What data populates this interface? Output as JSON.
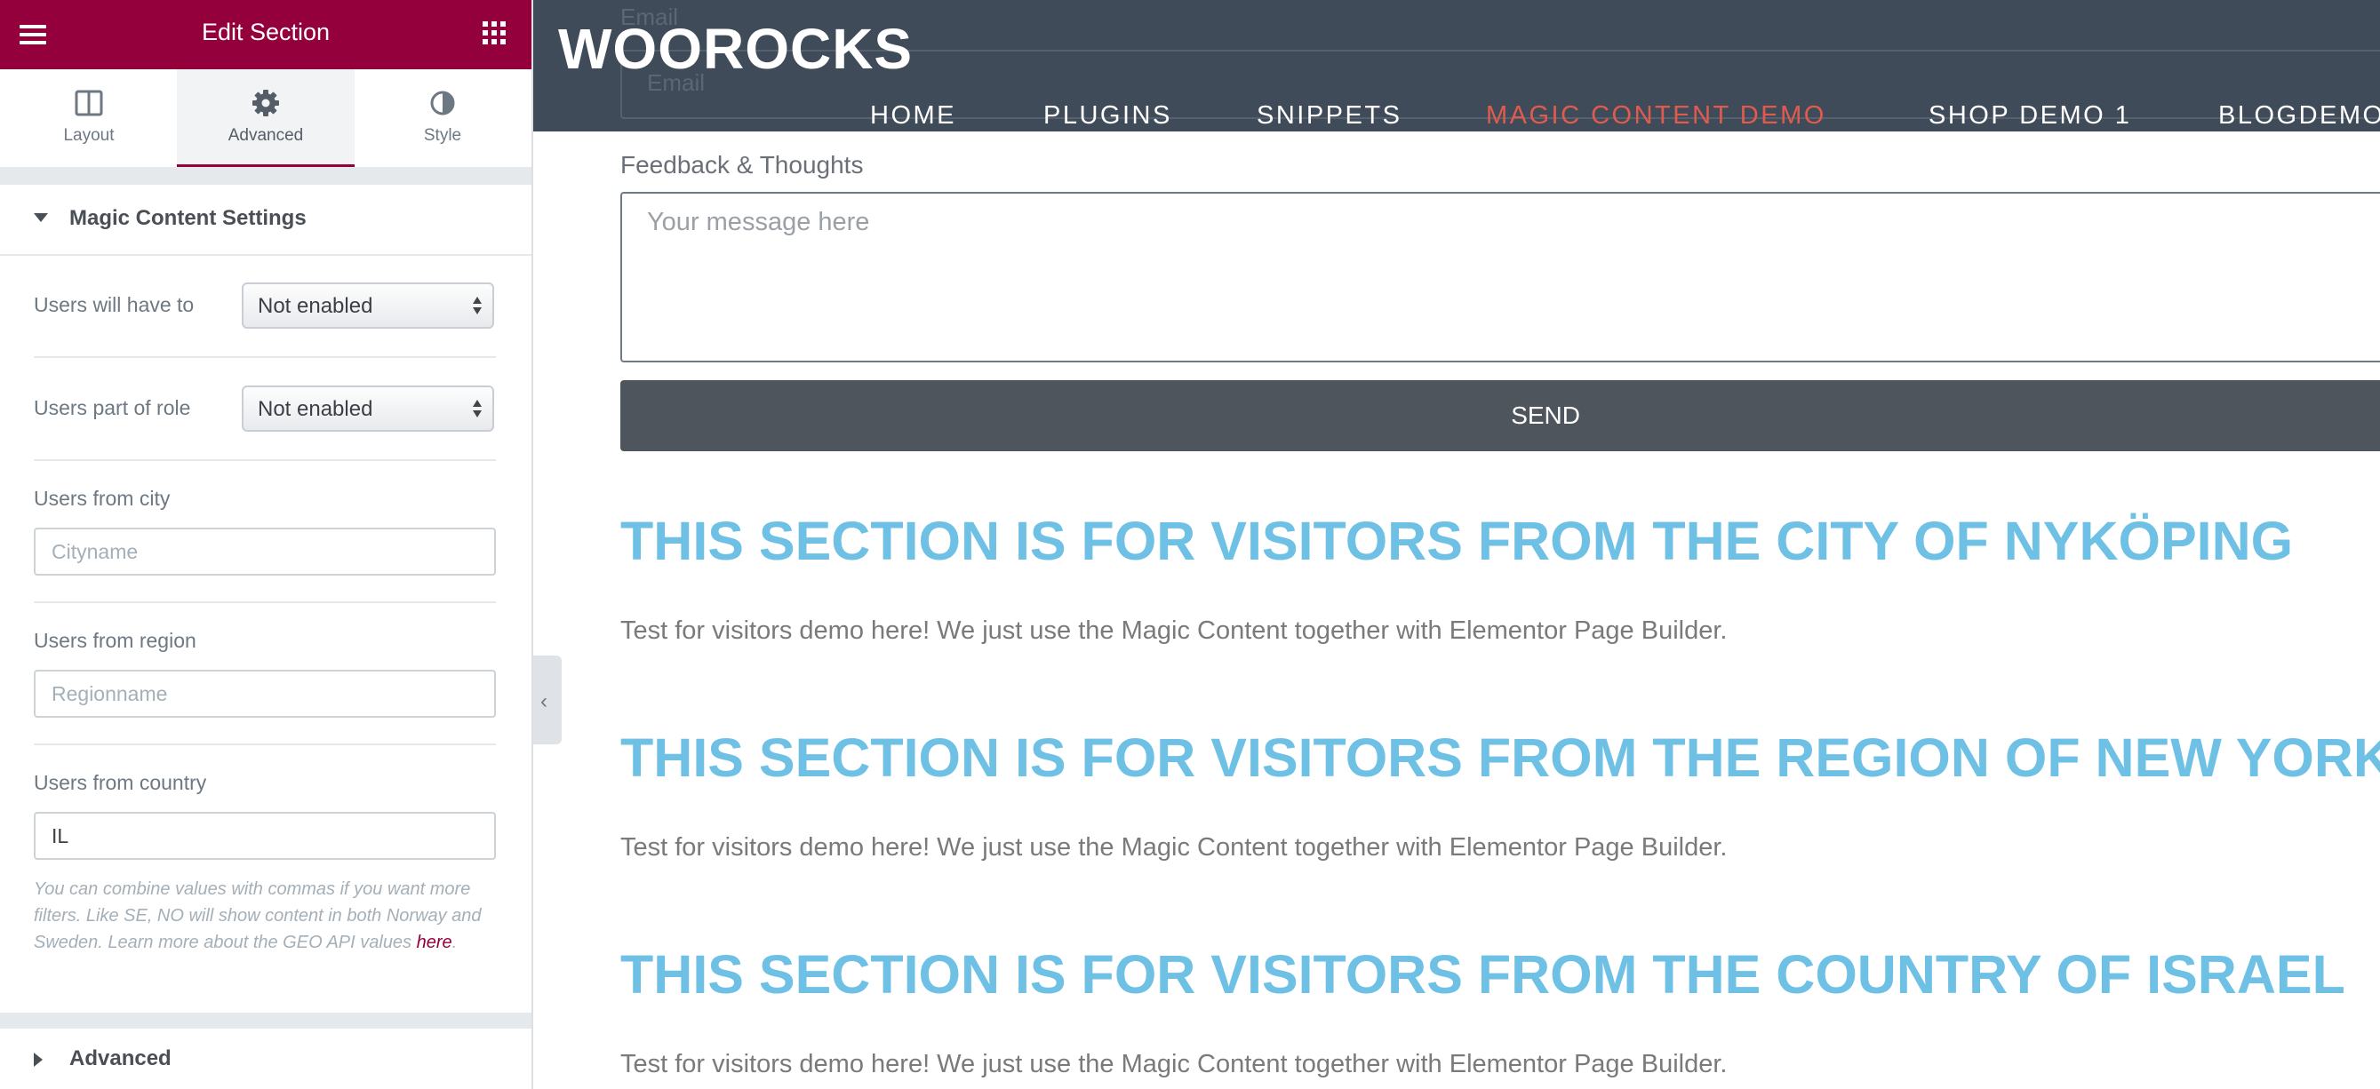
{
  "editor": {
    "title": "Edit Section",
    "menu_icon": "hamburger-menu-icon",
    "apps_icon": "grid-apps-icon",
    "tabs": [
      {
        "label": "Layout",
        "icon": "layout-columns-icon"
      },
      {
        "label": "Advanced",
        "icon": "gear-icon"
      },
      {
        "label": "Style",
        "icon": "half-circle-style-icon"
      }
    ],
    "active_tab": "Advanced",
    "magic_section": {
      "title": "Magic Content Settings",
      "expanded": true,
      "fields": {
        "have_to": {
          "label": "Users will have to",
          "value": "Not enabled"
        },
        "role": {
          "label": "Users part of role",
          "value": "Not enabled"
        },
        "city": {
          "label": "Users from city",
          "placeholder": "Cityname",
          "value": ""
        },
        "region": {
          "label": "Users from region",
          "placeholder": "Regionname",
          "value": ""
        },
        "country": {
          "label": "Users from country",
          "placeholder": "",
          "value": "IL"
        }
      },
      "help_text": "You can combine values with commas if you want more filters. Like SE, NO will show content in both Norway and Sweden. Learn more about the GEO API values ",
      "help_link": "here",
      "help_end": "."
    },
    "advanced_section": {
      "title": "Advanced",
      "expanded": false
    },
    "collapse_icon": "chevron-left-icon"
  },
  "site": {
    "logo": "WOOROCKS",
    "nav": [
      "HOME",
      "PLUGINS",
      "SNIPPETS",
      "MAGIC CONTENT DEMO",
      "SHOP DEMO 1",
      "BLOGDEMO"
    ],
    "active_nav": "MAGIC CONTENT DEMO",
    "ghost_email_label": "Email",
    "ghost_email_placeholder": "Email",
    "feedback_label": "Feedback & Thoughts",
    "feedback_placeholder": "Your message here",
    "send_label": "SEND",
    "sections": [
      {
        "heading": "THIS SECTION IS FOR VISITORS FROM THE CITY OF NYKÖPING",
        "text": "Test for visitors demo here! We just use the Magic Content together with Elementor Page Builder."
      },
      {
        "heading": "THIS SECTION IS FOR VISITORS FROM THE REGION OF NEW YORK",
        "text": "Test for visitors demo here! We just use the Magic Content together with Elementor Page Builder."
      },
      {
        "heading": "THIS SECTION IS FOR VISITORS FROM THE COUNTRY OF ISRAEL",
        "text": "Test for visitors demo here! We just use the Magic Content together with Elementor Page Builder."
      }
    ]
  },
  "colors": {
    "panel_header": "#93003c",
    "site_header": "#404b5a",
    "nav_active": "#e15b4d",
    "section_heading": "#6ec1e4",
    "send_button": "#4f555d"
  }
}
